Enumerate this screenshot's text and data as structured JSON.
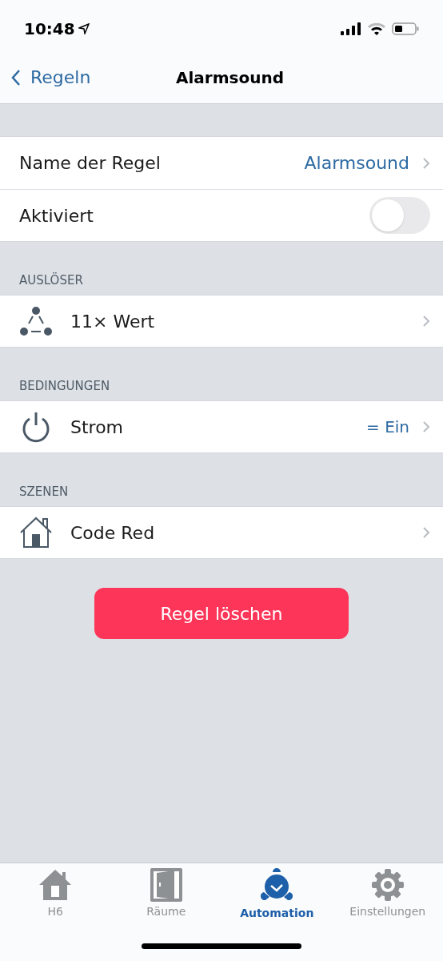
{
  "status_bar": {
    "time": "10:48"
  },
  "nav": {
    "back": "Regeln",
    "title": "Alarmsound"
  },
  "settings": [
    {
      "kind": "value",
      "label": "Name der Regel",
      "value": "Alarmsound"
    },
    {
      "kind": "toggle",
      "label": "Aktiviert",
      "on": false
    }
  ],
  "sections": [
    {
      "header": "AUSLÖSER",
      "rows": [
        {
          "label": "11× Wert"
        }
      ]
    },
    {
      "header": "BEDINGUNGEN",
      "rows": [
        {
          "label": "Strom",
          "value": "= Ein"
        }
      ]
    },
    {
      "header": "SZENEN",
      "rows": [
        {
          "label": "Code Red"
        }
      ]
    }
  ],
  "delete_button": "Regel löschen",
  "tabs": [
    {
      "label": "H6",
      "selected": false
    },
    {
      "label": "Räume",
      "selected": false
    },
    {
      "label": "Automation",
      "selected": true
    },
    {
      "label": "Einstellungen",
      "selected": false
    }
  ]
}
